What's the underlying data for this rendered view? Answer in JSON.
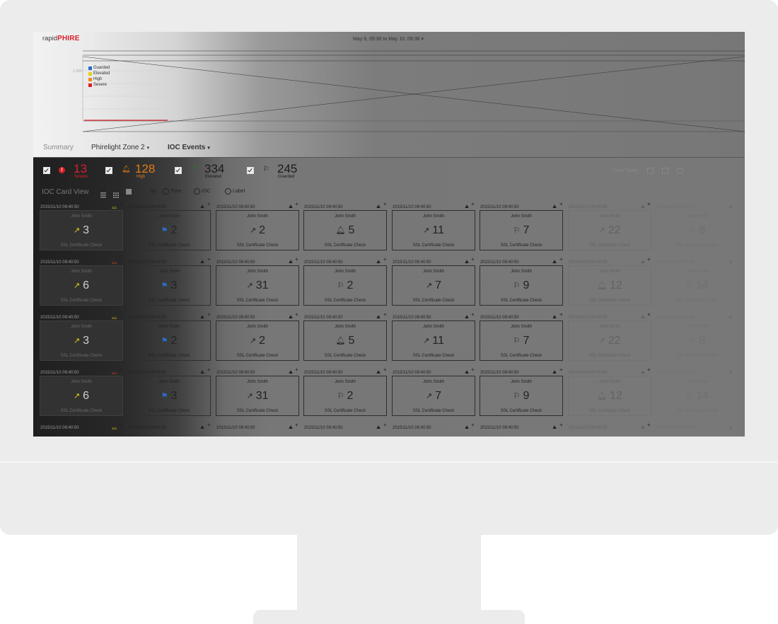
{
  "header": {
    "logo_prefix": "rapid",
    "logo_brand": "PHIRE",
    "date_range": "May 9, 09:36 to May 10, 09:36"
  },
  "chart_data": {
    "type": "line",
    "ytick_top": "1,000",
    "legend": [
      {
        "label": "Guarded",
        "color": "#2b6cc4"
      },
      {
        "label": "Elevated",
        "color": "#e3d21c"
      },
      {
        "label": "High",
        "color": "#f08a1c"
      },
      {
        "label": "Severe",
        "color": "#d8202b"
      }
    ]
  },
  "tabs": [
    {
      "label": "Summary"
    },
    {
      "label": "Phirelight  Zone 2"
    },
    {
      "label": "IOC Events"
    }
  ],
  "stats": [
    {
      "value": "13",
      "label": "Severe",
      "color": "#d8202b"
    },
    {
      "value": "128",
      "label": "High",
      "color": "#e07a18"
    },
    {
      "value": "334",
      "label": "Elevated",
      "color": "#1a1a1a"
    },
    {
      "value": "245",
      "label": "Guarded",
      "color": "#1a1a1a"
    }
  ],
  "view": {
    "title": "IOC Card View",
    "sort_label": "By",
    "sort_options": [
      "Time",
      "IOC",
      "Label"
    ],
    "conn_types": "Conn Types"
  },
  "cards": {
    "timestamp": "2015/11/10   09:40:50",
    "user": "John Smith",
    "check": "SSL Certificate Check",
    "rows": [
      [
        "3",
        "2",
        "2",
        "5",
        "11",
        "7",
        "22",
        "8"
      ],
      [
        "6",
        "3",
        "31",
        "2",
        "7",
        "9",
        "12",
        "14"
      ],
      [
        "3",
        "2",
        "2",
        "5",
        "11",
        "7",
        "22",
        "8"
      ],
      [
        "6",
        "3",
        "31",
        "2",
        "7",
        "9",
        "12",
        "14"
      ]
    ],
    "icons": [
      [
        "arrow",
        "flag-blue",
        "arrow",
        "bell",
        "arrow",
        "flag",
        "arrow",
        "flag"
      ],
      [
        "arrow",
        "flag-blue",
        "arrow",
        "flag",
        "arrow",
        "flag",
        "bell",
        "flag"
      ],
      [
        "arrow",
        "flag-blue",
        "arrow",
        "bell",
        "arrow",
        "flag",
        "arrow",
        "flag"
      ],
      [
        "arrow",
        "flag-blue",
        "arrow",
        "flag",
        "arrow",
        "flag",
        "bell",
        "flag"
      ]
    ]
  }
}
